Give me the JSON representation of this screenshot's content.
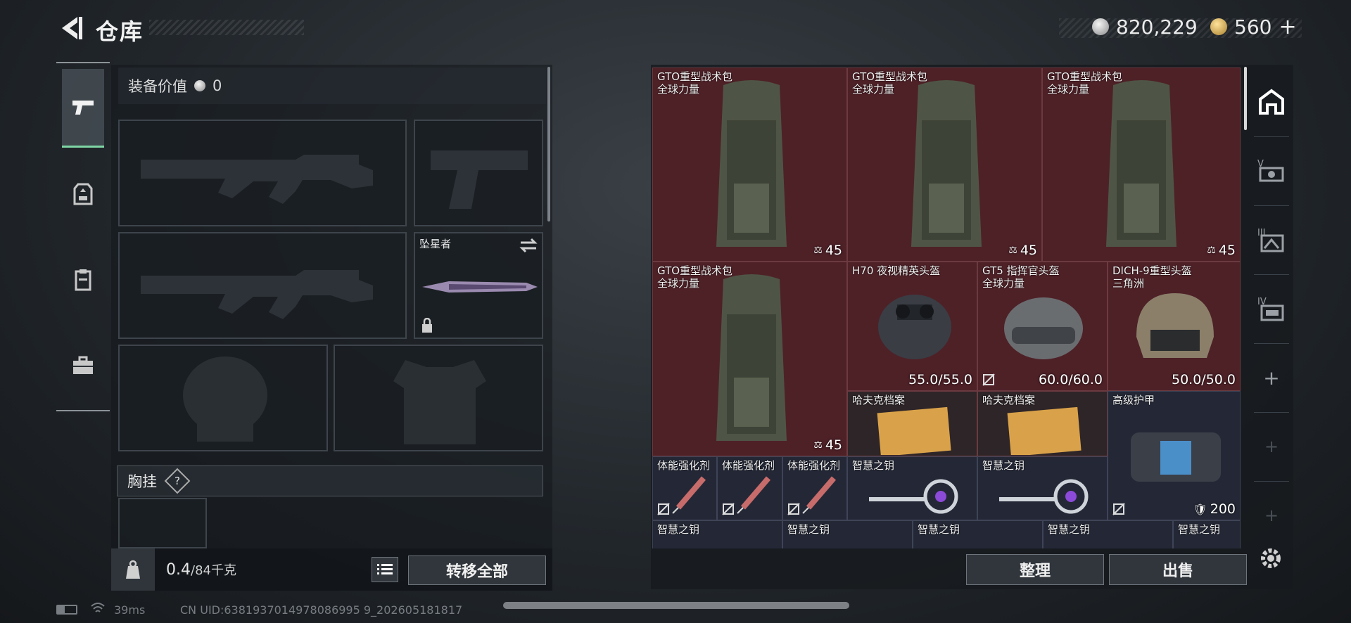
{
  "header": {
    "title": "仓库",
    "silver_amount": "820,229",
    "gold_amount": "560",
    "gold_plus": "+"
  },
  "left_tabs": [
    {
      "name": "weapons",
      "icon": "pistol-icon",
      "active": true
    },
    {
      "name": "gear",
      "icon": "armor-icon",
      "active": false
    },
    {
      "name": "clipboard",
      "icon": "clipboard-icon",
      "active": false
    },
    {
      "name": "case",
      "icon": "briefcase-icon",
      "active": false
    }
  ],
  "loadout": {
    "equipment_value_label": "装备价值",
    "equipment_value": "0",
    "melee_name": "坠星者",
    "chest_rig_label": "胸挂",
    "chest_rig_help": "?",
    "weight_current": "0.4",
    "weight_max": "/84千克",
    "transfer_all_label": "转移全部"
  },
  "stash_items": [
    {
      "name": "GTO重型战术包",
      "sub": "全球力量",
      "value": "45",
      "type": "backpack"
    },
    {
      "name": "GTO重型战术包",
      "sub": "全球力量",
      "value": "45",
      "type": "backpack"
    },
    {
      "name": "GTO重型战术包",
      "sub": "全球力量",
      "value": "45",
      "type": "backpack"
    },
    {
      "name": "GTO重型战术包",
      "sub": "全球力量",
      "value": "45",
      "type": "backpack"
    },
    {
      "name": "H70 夜视精英头盔",
      "sub": "",
      "value": "55.0/55.0",
      "type": "helmet"
    },
    {
      "name": "GT5 指挥官头盔",
      "sub": "全球力量",
      "value": "60.0/60.0",
      "type": "helmet"
    },
    {
      "name": "DICH-9重型头盔",
      "sub": "三角洲",
      "value": "50.0/50.0",
      "type": "helmet"
    },
    {
      "name": "哈夫克档案",
      "sub": "",
      "value": "",
      "type": "file"
    },
    {
      "name": "哈夫克档案",
      "sub": "",
      "value": "",
      "type": "file"
    },
    {
      "name": "高级护甲",
      "sub": "",
      "value": "200",
      "type": "armor"
    },
    {
      "name": "体能强化剂",
      "sub": "",
      "value": "",
      "type": "syringe"
    },
    {
      "name": "体能强化剂",
      "sub": "",
      "value": "",
      "type": "syringe"
    },
    {
      "name": "体能强化剂",
      "sub": "",
      "value": "",
      "type": "syringe"
    },
    {
      "name": "智慧之钥",
      "sub": "",
      "value": "",
      "type": "key"
    },
    {
      "name": "智慧之钥",
      "sub": "",
      "value": "",
      "type": "key"
    },
    {
      "name": "智慧之钥",
      "sub": "",
      "value": "",
      "type": "key"
    },
    {
      "name": "智慧之钥",
      "sub": "",
      "value": "",
      "type": "key"
    },
    {
      "name": "智慧之钥",
      "sub": "",
      "value": "",
      "type": "key"
    },
    {
      "name": "智慧之钥",
      "sub": "",
      "value": "",
      "type": "key"
    },
    {
      "name": "智慧之钥",
      "sub": "",
      "value": "",
      "type": "key"
    }
  ],
  "actions": {
    "sort_label": "整理",
    "sell_label": "出售"
  },
  "right_tabs": [
    {
      "icon": "home-stash-icon",
      "label": ""
    },
    {
      "icon": "stash-v-icon",
      "label": "V"
    },
    {
      "icon": "stash-iii-icon",
      "label": "III"
    },
    {
      "icon": "stash-iv-icon",
      "label": "IV"
    },
    {
      "icon": "add-icon",
      "label": "+"
    },
    {
      "icon": "add-icon",
      "label": "+"
    },
    {
      "icon": "add-icon",
      "label": "+"
    }
  ],
  "status_bar": {
    "ping": "39ms",
    "uid": "CN UID:6381937014978086995 9_202605181817"
  },
  "colors": {
    "accent_green": "#7fd6a5",
    "cell_red": "#4e2127",
    "cell_blue": "#242836"
  }
}
